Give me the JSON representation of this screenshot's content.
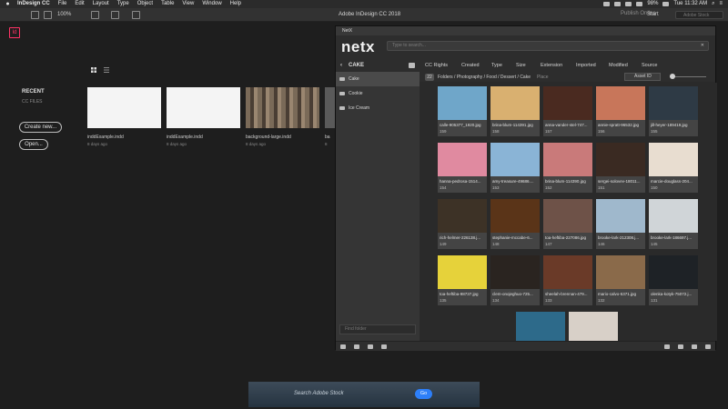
{
  "menubar": {
    "app_name": "InDesign CC",
    "items": [
      "File",
      "Edit",
      "Layout",
      "Type",
      "Object",
      "Table",
      "View",
      "Window",
      "Help"
    ],
    "battery": "98%",
    "clock": "Tue 11:32 AM"
  },
  "appbar": {
    "zoom": "100%",
    "title": "Adobe InDesign CC 2018",
    "publish_label": "Publish Online",
    "workspace_label": "Start",
    "search_placeholder": "Adobe Stock"
  },
  "start": {
    "app_badge": "Id",
    "recent_label": "RECENT",
    "ccfiles_label": "CC FILES",
    "create_button": "Create new...",
    "open_button": "Open...",
    "files": [
      {
        "name": "inddExample.indd",
        "date": "8 days ago",
        "color": "#f4f4f4"
      },
      {
        "name": "inddExample.indd",
        "date": "8 days ago",
        "color": "#f4f4f4"
      },
      {
        "name": "background-large.indd",
        "date": "8 days ago",
        "color": "#6a5a4a"
      },
      {
        "name": "ba",
        "date": "8",
        "color": "#5a5a5a"
      }
    ]
  },
  "netx": {
    "tab_label": "NetX",
    "brand": "netx",
    "search_placeholder": "Type to search...",
    "folder_name": "CAKE",
    "filters": [
      "CC Rights",
      "Created",
      "Type",
      "Size",
      "Extension",
      "Imported",
      "Modified",
      "Source"
    ],
    "folders": [
      "Cake",
      "Cookie",
      "Ice Cream"
    ],
    "find_folder_placeholder": "Find folder",
    "asset_count": "22",
    "breadcrumb": "Folders / Photography / Food / Dessert / Cake",
    "place_label": "Place",
    "sort_label": "Asset ID",
    "assets": [
      {
        "file": "calle-905377_1920.jpg",
        "id": "159",
        "color": "#6fa6c9"
      },
      {
        "file": "brina-blum-114391.jpg",
        "id": "158",
        "color": "#d9b070"
      },
      {
        "file": "anna-vander-stel-747...",
        "id": "157",
        "color": "#4a2a20"
      },
      {
        "file": "annie-spratt-96532.jpg",
        "id": "156",
        "color": "#c8765a"
      },
      {
        "file": "jill-heyer-189419.jpg",
        "id": "155",
        "color": "#2e3a45"
      },
      {
        "file": "hanna-pedrosa-1514...",
        "id": "154",
        "color": "#e08aa0"
      },
      {
        "file": "amy-treasure-49686....",
        "id": "153",
        "color": "#8ab4d6"
      },
      {
        "file": "brina-blum-114390.jpg",
        "id": "152",
        "color": "#c97a7a"
      },
      {
        "file": "sergei-solovev-18011...",
        "id": "151",
        "color": "#3a2a22"
      },
      {
        "file": "marcie-douglass-204...",
        "id": "150",
        "color": "#e8ddd0"
      },
      {
        "file": "rich-helmer-226138.j...",
        "id": "149",
        "color": "#3d3226"
      },
      {
        "file": "stephanie-mccabe-6...",
        "id": "148",
        "color": "#5a3418"
      },
      {
        "file": "toa-heftiba-227086.jpg",
        "id": "147",
        "color": "#6e5248"
      },
      {
        "file": "brooke-lark-212308.j...",
        "id": "146",
        "color": "#9fb8cc"
      },
      {
        "file": "brooke-lark-186697.j...",
        "id": "145",
        "color": "#d0d5d8"
      },
      {
        "file": "toa-heftiba-98737.jpg",
        "id": "135",
        "color": "#e6d23a"
      },
      {
        "file": "clem-onojeghuo-725...",
        "id": "134",
        "color": "#2a2420"
      },
      {
        "file": "sheelah-brennan-479...",
        "id": "133",
        "color": "#6a3a28"
      },
      {
        "file": "mario-calvo-5371.jpg",
        "id": "132",
        "color": "#8a6a4a"
      },
      {
        "file": "olenka-kotyk-75072.j...",
        "id": "131",
        "color": "#1e2226"
      },
      {
        "file": "",
        "id": "",
        "color": "#2d6a8a"
      },
      {
        "file": "",
        "id": "",
        "color": "#d8d0c8"
      }
    ]
  },
  "stock": {
    "search_placeholder": "Search Adobe Stock",
    "go_label": "Go"
  }
}
